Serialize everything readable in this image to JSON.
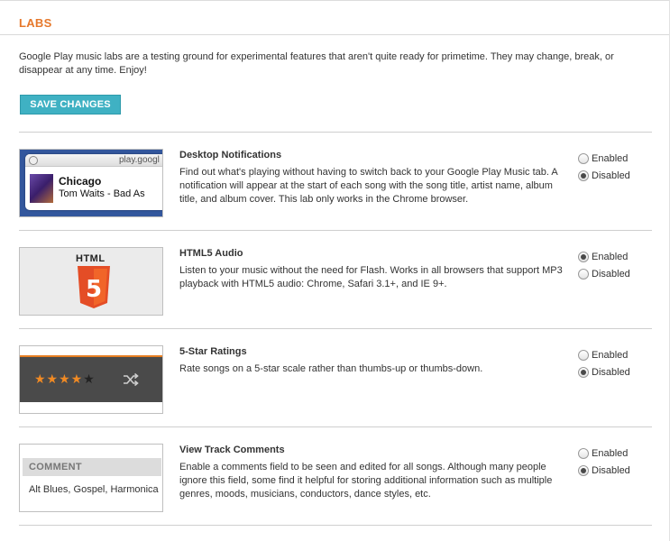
{
  "page": {
    "title": "LABS",
    "intro": "Google Play music labs are a testing ground for experimental features that aren't quite ready for primetime. They may change, break, or disappear at any time. Enjoy!",
    "save_label": "SAVE CHANGES"
  },
  "option_labels": {
    "enabled": "Enabled",
    "disabled": "Disabled"
  },
  "labs": [
    {
      "name": "Desktop Notifications",
      "description": "Find out what's playing without having to switch back to your Google Play Music tab. A notification will appear at the start of each song with the song title, artist name, album title, and album cover. This lab only works in the Chrome browser.",
      "selected": "disabled",
      "thumb": {
        "domain": "play.googl",
        "song": "Chicago",
        "artist": "Tom Waits - Bad As"
      }
    },
    {
      "name": "HTML5 Audio",
      "description": "Listen to your music without the need for Flash. Works in all browsers that support MP3 playback with HTML5 audio: Chrome, Safari 3.1+, and IE 9+.",
      "selected": "enabled",
      "thumb": {
        "logo_text": "HTML",
        "logo_number": "5",
        "logo_color": "#e44d26"
      }
    },
    {
      "name": "5-Star Ratings",
      "description": "Rate songs on a 5-star scale rather than thumbs-up or thumbs-down.",
      "selected": "disabled",
      "thumb": {
        "filled_stars": "★★★★",
        "empty_stars": "★",
        "star_color": "#f08a24",
        "icon": "shuffle-icon"
      }
    },
    {
      "name": "View Track Comments",
      "description": "Enable a comments field to be seen and edited for all songs. Although many people ignore this field, some find it helpful for storing additional information such as multiple genres, moods, musicians, conductors, dance styles, etc.",
      "selected": "disabled",
      "thumb": {
        "header": "COMMENT",
        "body": "Alt Blues, Gospel, Harmonica"
      }
    }
  ],
  "colors": {
    "accent_orange": "#e6782b",
    "button_teal": "#3fb1c3"
  }
}
